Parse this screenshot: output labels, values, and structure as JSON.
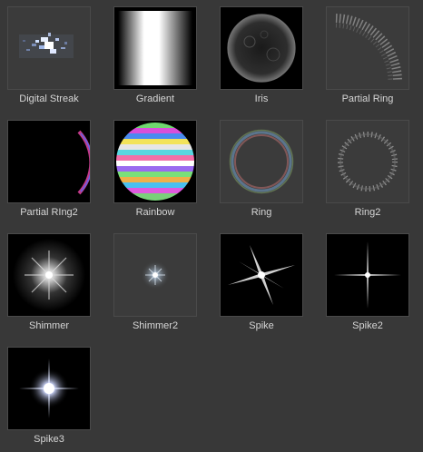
{
  "assets": [
    {
      "name": "Digital Streak",
      "icon": "digital-streak-texture"
    },
    {
      "name": "Gradient",
      "icon": "gradient-texture"
    },
    {
      "name": "Iris",
      "icon": "iris-texture"
    },
    {
      "name": "Partial Ring",
      "icon": "partial-ring-texture"
    },
    {
      "name": "Partial RIng2",
      "icon": "partial-ring2-texture"
    },
    {
      "name": "Rainbow",
      "icon": "rainbow-texture"
    },
    {
      "name": "Ring",
      "icon": "ring-texture"
    },
    {
      "name": "Ring2",
      "icon": "ring2-texture"
    },
    {
      "name": "Shimmer",
      "icon": "shimmer-texture"
    },
    {
      "name": "Shimmer2",
      "icon": "shimmer2-texture"
    },
    {
      "name": "Spike",
      "icon": "spike-texture"
    },
    {
      "name": "Spike2",
      "icon": "spike2-texture"
    },
    {
      "name": "Spike3",
      "icon": "spike3-texture"
    }
  ]
}
